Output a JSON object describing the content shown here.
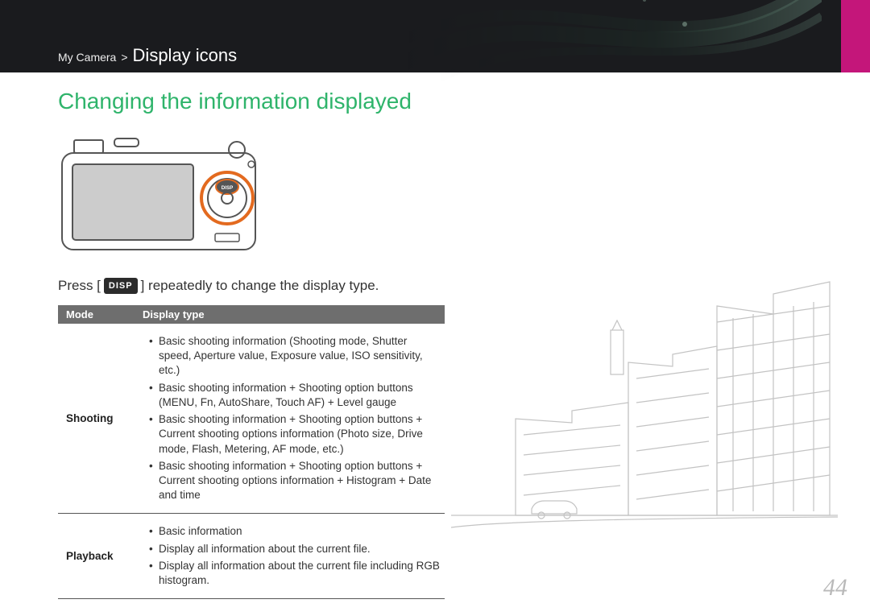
{
  "breadcrumb": {
    "parent": "My Camera",
    "separator": ">",
    "current": "Display icons"
  },
  "page_heading": "Changing the information displayed",
  "instruction": {
    "prefix": "Press [",
    "button_label": "DISP",
    "suffix": "] repeatedly to change the display type."
  },
  "table": {
    "headers": {
      "mode": "Mode",
      "display_type": "Display type"
    },
    "rows": [
      {
        "mode": "Shooting",
        "items": [
          "Basic shooting information (Shooting mode, Shutter speed, Aperture value, Exposure value, ISO sensitivity, etc.)",
          "Basic shooting information + Shooting option buttons (MENU, Fn, AutoShare, Touch AF) + Level gauge",
          "Basic shooting information + Shooting option buttons + Current shooting options information (Photo size, Drive mode, Flash, Metering, AF mode, etc.)",
          "Basic shooting information + Shooting option buttons + Current shooting options information + Histogram + Date and time"
        ]
      },
      {
        "mode": "Playback",
        "items": [
          "Basic information",
          "Display all information about the current file.",
          "Display all information about the current file including RGB histogram."
        ]
      }
    ]
  },
  "page_number": "44"
}
